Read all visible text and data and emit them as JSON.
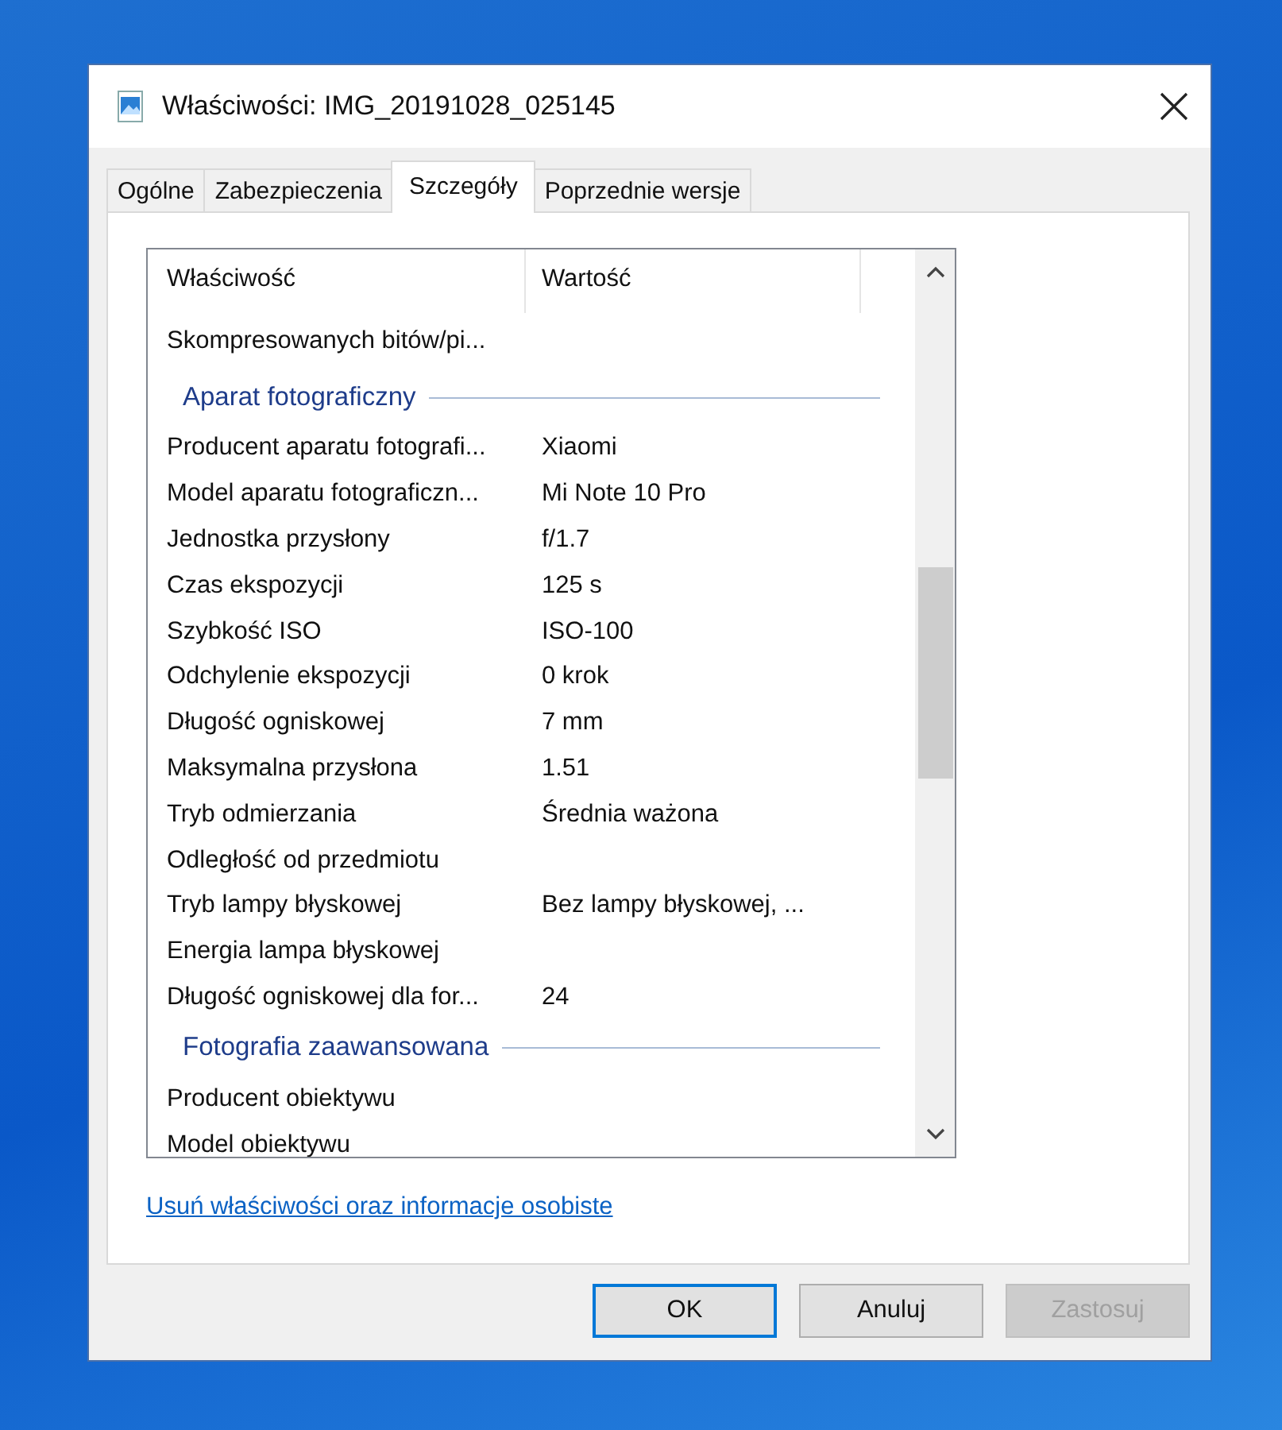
{
  "window": {
    "title": "Właściwości: IMG_20191028_025145"
  },
  "tabs": [
    {
      "label": "Ogólne",
      "selected": false
    },
    {
      "label": "Zabezpieczenia",
      "selected": false
    },
    {
      "label": "Szczegóły",
      "selected": true
    },
    {
      "label": "Poprzednie wersje",
      "selected": false
    }
  ],
  "table": {
    "columns": [
      "Właściwość",
      "Wartość"
    ],
    "rows": [
      {
        "kind": "property",
        "name": "Skompresowanych bitów/pi...",
        "value": ""
      },
      {
        "kind": "group",
        "name": "Aparat fotograficzny"
      },
      {
        "kind": "property",
        "name": "Producent aparatu fotografi...",
        "value": "Xiaomi"
      },
      {
        "kind": "property",
        "name": "Model aparatu fotograficzn...",
        "value": "Mi Note 10 Pro"
      },
      {
        "kind": "property",
        "name": "Jednostka przysłony",
        "value": "f/1.7"
      },
      {
        "kind": "property",
        "name": "Czas ekspozycji",
        "value": "125 s"
      },
      {
        "kind": "property",
        "name": "Szybkość ISO",
        "value": "ISO-100"
      },
      {
        "kind": "property",
        "name": "Odchylenie ekspozycji",
        "value": "0 krok"
      },
      {
        "kind": "property",
        "name": "Długość ogniskowej",
        "value": "7 mm"
      },
      {
        "kind": "property",
        "name": "Maksymalna przysłona",
        "value": "1.51"
      },
      {
        "kind": "property",
        "name": "Tryb odmierzania",
        "value": "Średnia ważona"
      },
      {
        "kind": "property",
        "name": "Odległość od przedmiotu",
        "value": ""
      },
      {
        "kind": "property",
        "name": "Tryb lampy błyskowej",
        "value": "Bez lampy błyskowej, ..."
      },
      {
        "kind": "property",
        "name": "Energia lampa błyskowej",
        "value": ""
      },
      {
        "kind": "property",
        "name": "Długość ogniskowej dla for...",
        "value": "24"
      },
      {
        "kind": "group",
        "name": "Fotografia zaawansowana"
      },
      {
        "kind": "property",
        "name": "Producent obiektywu",
        "value": ""
      },
      {
        "kind": "property",
        "name": "Model obiektywu",
        "value": ""
      }
    ]
  },
  "link": "Usuń właściwości oraz informacje osobiste",
  "buttons": [
    {
      "label": "OK",
      "default": true,
      "disabled": false
    },
    {
      "label": "Anuluj",
      "default": false,
      "disabled": false
    },
    {
      "label": "Zastosuj",
      "default": false,
      "disabled": true
    }
  ]
}
